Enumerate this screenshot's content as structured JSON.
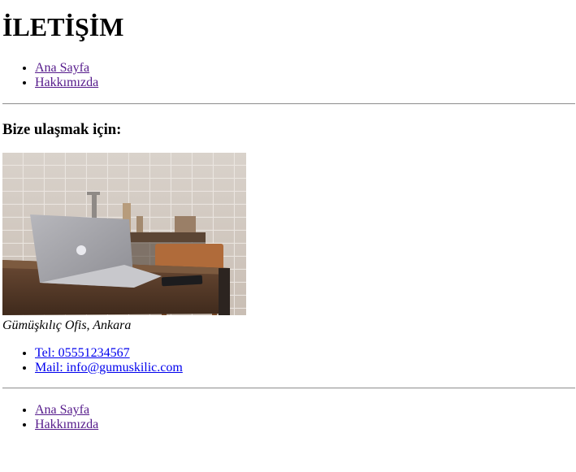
{
  "page": {
    "title": "İLETİŞİM",
    "subtitle": "Bize ulaşmak için:",
    "caption": "Gümüşkılıç Ofis, Ankara"
  },
  "nav_top": {
    "items": [
      "Ana Sayfa",
      "Hakkımızda"
    ]
  },
  "contact": {
    "items": [
      "Tel: 05551234567",
      "Mail: info@gumuskilic.com"
    ]
  },
  "nav_bottom": {
    "items": [
      "Ana Sayfa",
      "Hakkımızda"
    ]
  },
  "photo": {
    "subject": "laptop-on-wooden-table",
    "alt": ""
  },
  "colors": {
    "visited_link": "#551a8b",
    "link": "#0000ee",
    "rule": "#9a9a9a"
  }
}
